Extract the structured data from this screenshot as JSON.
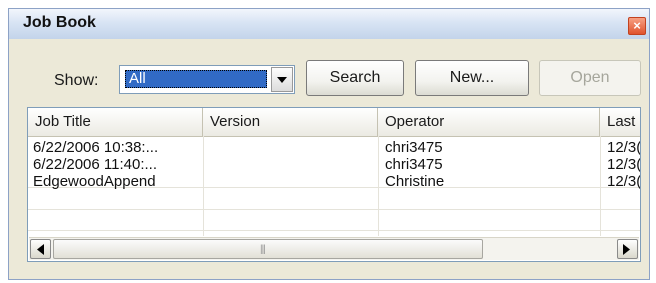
{
  "window": {
    "title": "Job Book",
    "close_label": "×"
  },
  "toolbar": {
    "show_label": "Show:",
    "show_value": "All",
    "search_label": "Search",
    "new_label": "New...",
    "open_label": "Open"
  },
  "grid": {
    "columns": [
      "Job Title",
      "Version",
      "Operator",
      "Last I"
    ],
    "rows": [
      {
        "job_title": "6/22/2006 10:38:...",
        "version": "",
        "operator": "chri3475",
        "last": "12/3("
      },
      {
        "job_title": "6/22/2006 11:40:...",
        "version": "",
        "operator": "chri3475",
        "last": "12/3("
      },
      {
        "job_title": "EdgewoodAppend",
        "version": "",
        "operator": "Christine",
        "last": "12/3("
      }
    ]
  },
  "scrollbar": {
    "grip": "|||"
  }
}
